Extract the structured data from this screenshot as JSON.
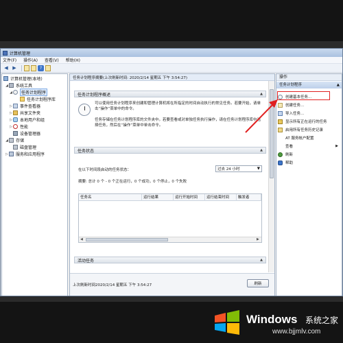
{
  "window": {
    "title": "计算机管理"
  },
  "menu": [
    "文件(F)",
    "操作(A)",
    "查看(V)",
    "帮助(H)"
  ],
  "tree": {
    "items": [
      {
        "label": "计算机管理(本地)",
        "icon": "computer-icon"
      },
      {
        "label": "系统工具",
        "icon": "tools-icon"
      },
      {
        "label": "任务计划程序",
        "icon": "clock-icon"
      },
      {
        "label": "任务计划程序库",
        "icon": "folder-icon"
      },
      {
        "label": "事件查看器",
        "icon": "event-log-icon"
      },
      {
        "label": "共享文件夹",
        "icon": "shared-folder-icon"
      },
      {
        "label": "本地用户和组",
        "icon": "users-icon"
      },
      {
        "label": "性能",
        "icon": "performance-icon"
      },
      {
        "label": "设备管理器",
        "icon": "device-icon"
      },
      {
        "label": "存储",
        "icon": "storage-icon"
      },
      {
        "label": "磁盘管理",
        "icon": "disk-icon"
      },
      {
        "label": "服务和应用程序",
        "icon": "services-icon"
      }
    ]
  },
  "center": {
    "header": "任务计划程序摘要(上次刷新时间: 2020/2/14 星期五 下午 3:54:27)",
    "overview": {
      "title": "任务计划程序概述",
      "line1": "可以使用任务计划程序来创建和管理计算机将在所指定的时间自动执行的常见任务。若要开始，请单击“操作”菜单中的命令。",
      "line2": "任务存储在任务计划程序库的文件夹中。若要查看或对单独任务执行操作，请在任务计划程序库中选择任务，然后在“操作”菜单中单击命令。"
    },
    "status": {
      "title": "任务状态",
      "filter_label": "在以下时间段启动的任务状态：",
      "filter_value": "过去 24 小时",
      "summary": "摘要: 总计 0 个 - 0 个正在运行，0 个成功，0 个停止，0 个失败",
      "columns": [
        "任务名",
        "运行结果",
        "运行开始时间",
        "运行结束时间",
        "触发者"
      ]
    },
    "active": {
      "title": "活动任务"
    },
    "footer": {
      "last_refresh": "上次刷新时间2020/2/14 星期五 下午 3:54:27",
      "refresh_label": "刷新"
    }
  },
  "actions": {
    "title": "操作",
    "section": "任务计划程序",
    "items": [
      {
        "label": "创建基本任务...",
        "icon": "clock-icon"
      },
      {
        "label": "创建任务...",
        "icon": "task-icon"
      },
      {
        "label": "导入任务...",
        "icon": "import-icon"
      },
      {
        "label": "显示所有正在运行的任务",
        "icon": "running-tasks-icon"
      },
      {
        "label": "启用所有任务历史记录",
        "icon": "history-icon"
      },
      {
        "label": "AT 服务帐户配置",
        "icon": ""
      },
      {
        "label": "查看",
        "icon": ""
      },
      {
        "label": "刷新",
        "icon": "refresh-icon"
      },
      {
        "label": "帮助",
        "icon": "help-icon"
      }
    ]
  },
  "watermark": {
    "brand": "Windows",
    "cn": "系统之家",
    "url": "www.bjjmlv.com"
  },
  "colors": {
    "highlight": "#e02020",
    "window_border": "#6b7f99"
  }
}
